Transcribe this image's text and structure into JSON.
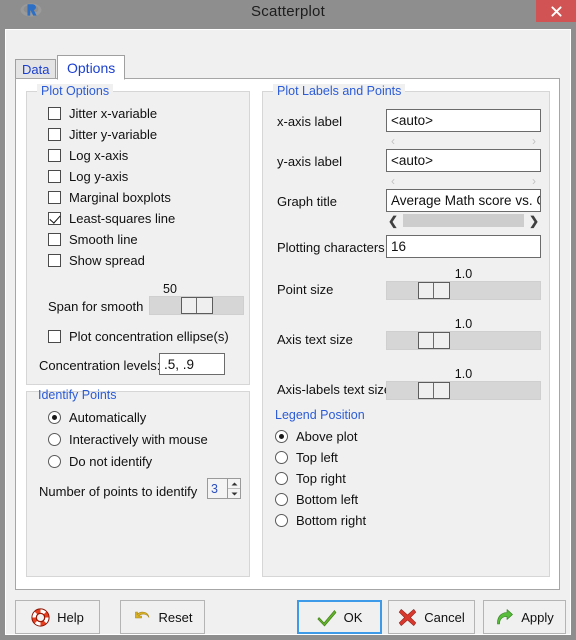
{
  "window": {
    "title": "Scatterplot",
    "app_icon": "r-logo-icon",
    "close_label": "×"
  },
  "tabs": [
    {
      "label": "Data",
      "active": false
    },
    {
      "label": "Options",
      "active": true
    }
  ],
  "plot_options": {
    "title": "Plot Options",
    "checkboxes": [
      {
        "label": "Jitter x-variable",
        "checked": false
      },
      {
        "label": "Jitter y-variable",
        "checked": false
      },
      {
        "label": "Log x-axis",
        "checked": false
      },
      {
        "label": "Log y-axis",
        "checked": false
      },
      {
        "label": "Marginal boxplots",
        "checked": false
      },
      {
        "label": "Least-squares line",
        "checked": true
      },
      {
        "label": "Smooth line",
        "checked": false
      },
      {
        "label": "Show spread",
        "checked": false
      }
    ],
    "span_label": "Span for smooth",
    "span_value": "50",
    "ellipse_label": "Plot concentration ellipse(s)",
    "ellipse_checked": false,
    "levels_label": "Concentration levels:",
    "levels_value": ".5, .9"
  },
  "identify_points": {
    "title": "Identify Points",
    "options": [
      {
        "label": "Automatically",
        "selected": true
      },
      {
        "label": "Interactively with mouse",
        "selected": false
      },
      {
        "label": "Do not identify",
        "selected": false
      }
    ],
    "count_label": "Number of points to identify",
    "count_value": "3"
  },
  "plot_labels": {
    "title": "Plot Labels and Points",
    "x_axis_label": "x-axis label",
    "x_axis_value": "<auto>",
    "y_axis_label": "y-axis label",
    "y_axis_value": "<auto>",
    "graph_title_label": "Graph title",
    "graph_title_value": "Average Math score vs. GDP",
    "plotting_chars_label": "Plotting characters",
    "plotting_chars_value": "16",
    "sliders": [
      {
        "label": "Point size",
        "value": "1.0"
      },
      {
        "label": "Axis text size",
        "value": "1.0"
      },
      {
        "label": "Axis-labels text size",
        "value": "1.0"
      }
    ],
    "scroll_left": "‹",
    "scroll_right": "›",
    "scroll_left_active": "❮",
    "scroll_right_active": "❯"
  },
  "legend_position": {
    "title": "Legend Position",
    "options": [
      {
        "label": "Above plot",
        "selected": true
      },
      {
        "label": "Top left",
        "selected": false
      },
      {
        "label": "Top right",
        "selected": false
      },
      {
        "label": "Bottom left",
        "selected": false
      },
      {
        "label": "Bottom right",
        "selected": false
      }
    ]
  },
  "buttons": [
    {
      "label": "Help",
      "icon": "lifebuoy-icon",
      "focused": false
    },
    {
      "label": "Reset",
      "icon": "undo-arrow-icon",
      "focused": false
    },
    {
      "label": "OK",
      "icon": "green-check-icon",
      "focused": true
    },
    {
      "label": "Cancel",
      "icon": "red-x-icon",
      "focused": false
    },
    {
      "label": "Apply",
      "icon": "green-arrow-icon",
      "focused": false
    }
  ],
  "colors": {
    "titlebar": "#8e8e8e",
    "close_button": "#d25353",
    "group_title": "#2b5bd7",
    "tab_text": "#1a3fd0",
    "focus_border": "#3d9ae8"
  }
}
